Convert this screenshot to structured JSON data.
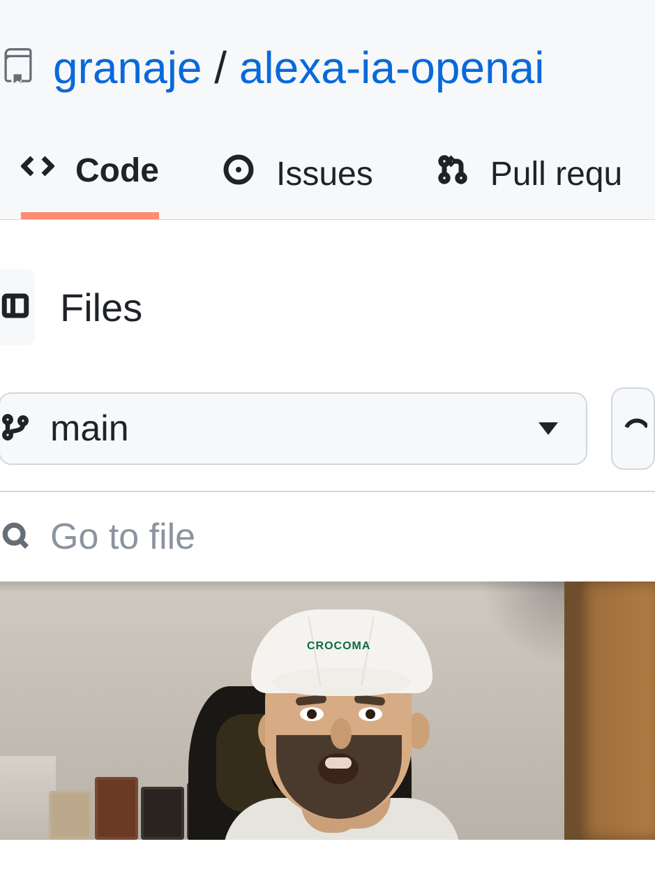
{
  "breadcrumb": {
    "owner": "granaje",
    "separator": "/",
    "repo": "alexa-ia-openai"
  },
  "tabs": {
    "code": "Code",
    "issues": "Issues",
    "pull_requests": "Pull requ"
  },
  "files": {
    "panel_title": "Files",
    "branch": "main",
    "go_to_file_placeholder": "Go to file"
  },
  "overlay": {
    "cap_text": "CROCOMA"
  }
}
